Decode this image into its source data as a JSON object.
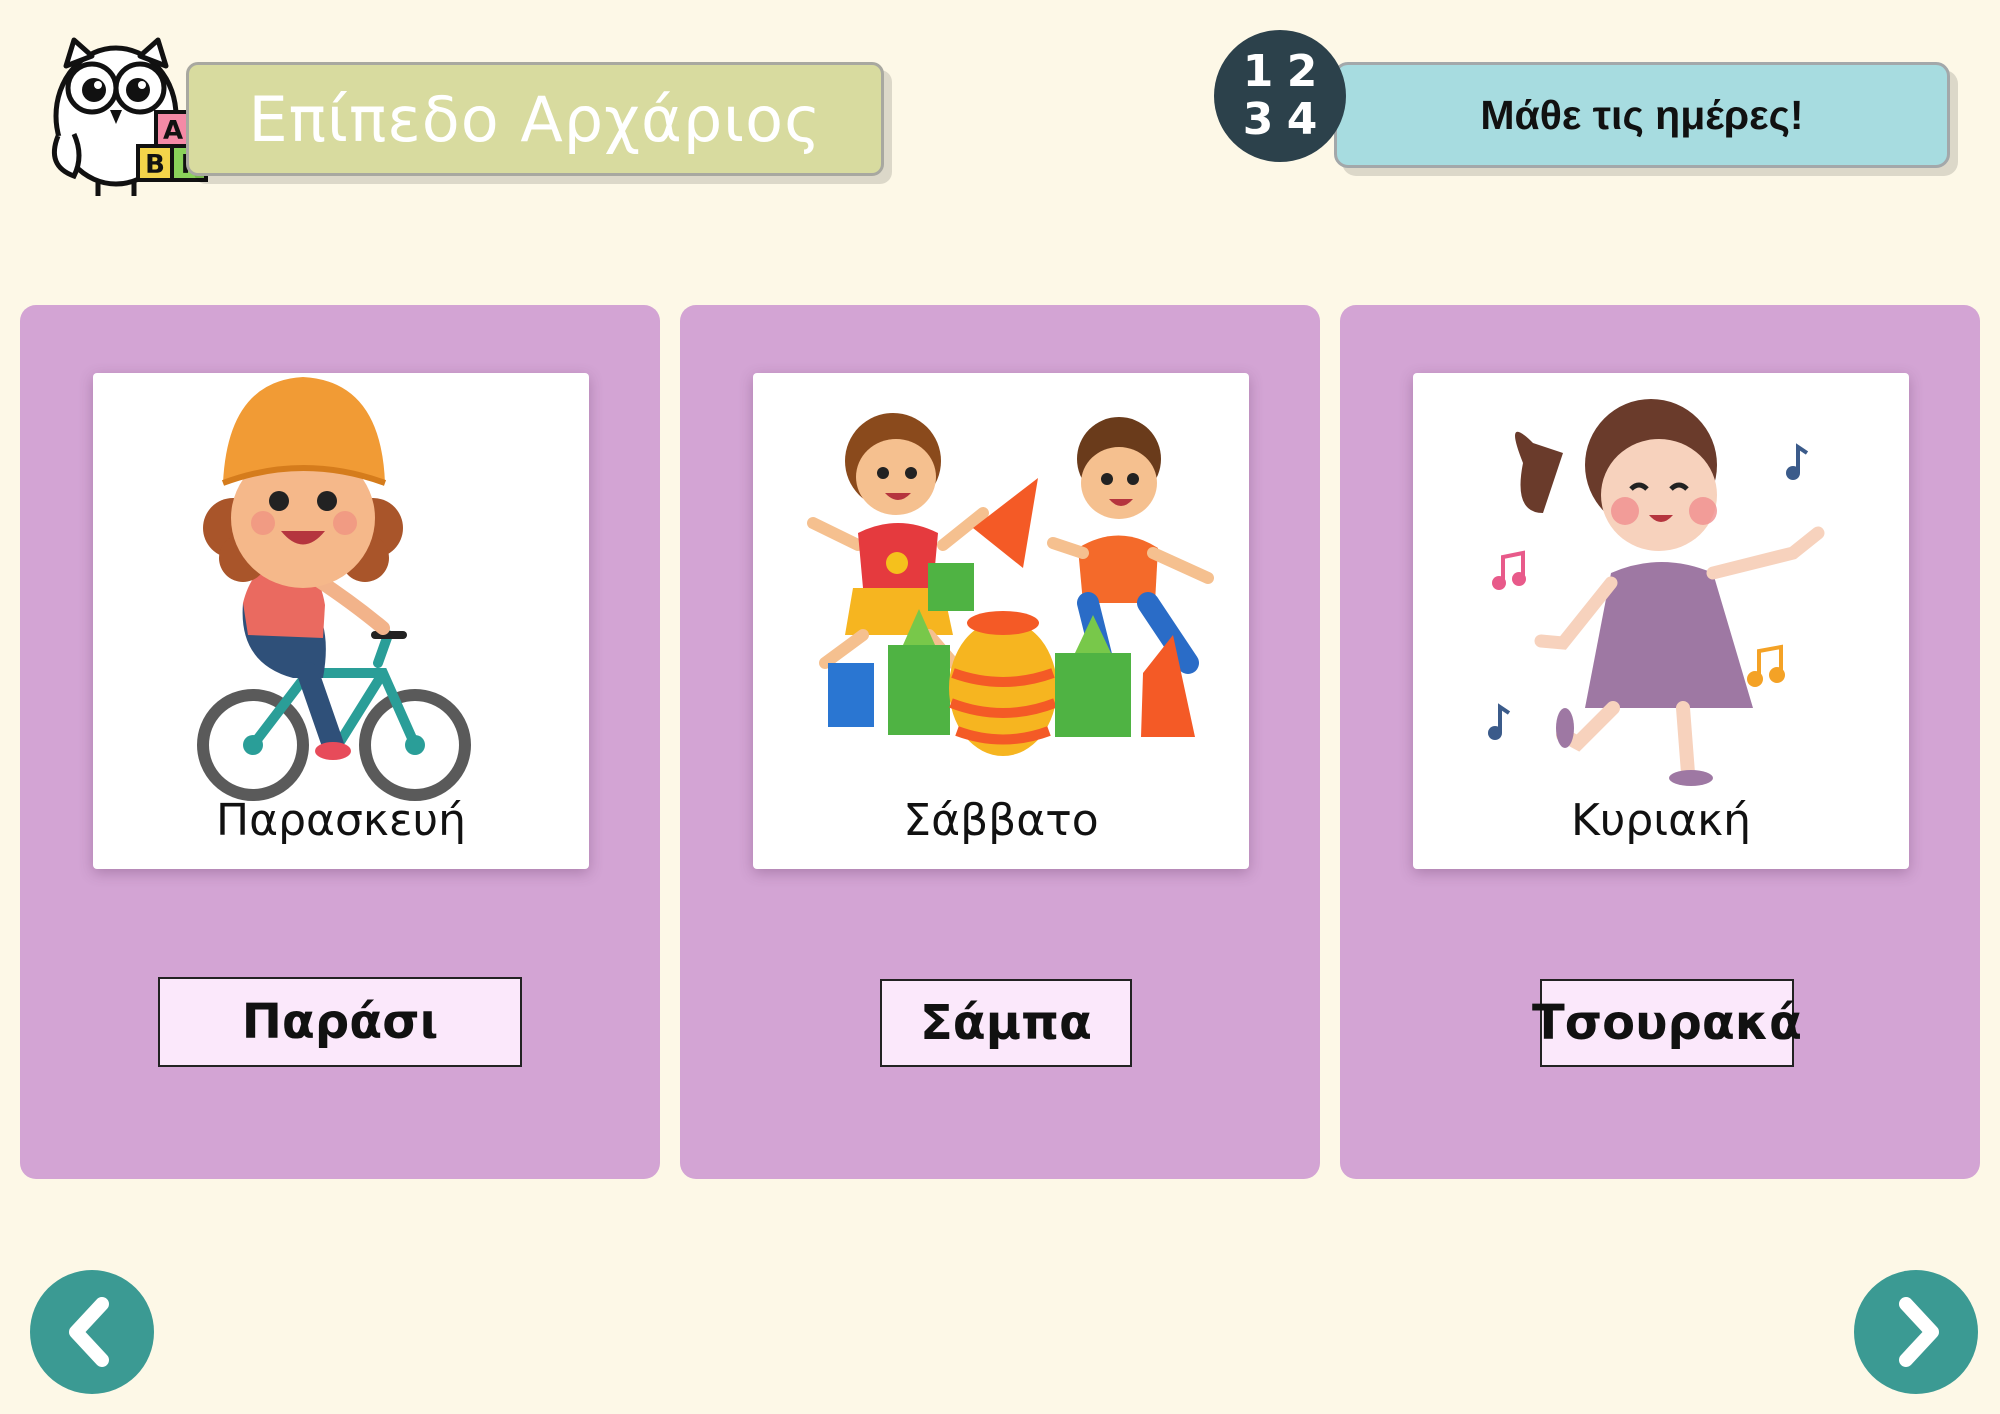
{
  "header": {
    "level_title": "Επίπεδο Αρχάριος",
    "logo_blocks": [
      "Α",
      "Β",
      "Γ"
    ],
    "numbers_icon": [
      "1",
      "2",
      "3",
      "4"
    ],
    "lesson_title": "Μάθε τις ημέρες!"
  },
  "cards": [
    {
      "day": "Παρασκευή",
      "answer": "Παράσι",
      "image_icon": "girl-riding-bike"
    },
    {
      "day": "Σάββατο",
      "answer": "Σάμπα",
      "image_icon": "kids-playing-blocks"
    },
    {
      "day": "Κυριακή",
      "answer": "Τσουρακά",
      "image_icon": "girl-dancing-music"
    }
  ],
  "navigation": {
    "prev_icon": "chevron-left-icon",
    "next_icon": "chevron-right-icon"
  },
  "colors": {
    "background": "#fdf8e7",
    "card": "#d3a4d4",
    "answer_box": "#fbe8fb",
    "level_banner": "#d8db9f",
    "title_banner": "#a7dce0",
    "nav_button": "#3b9a93"
  }
}
